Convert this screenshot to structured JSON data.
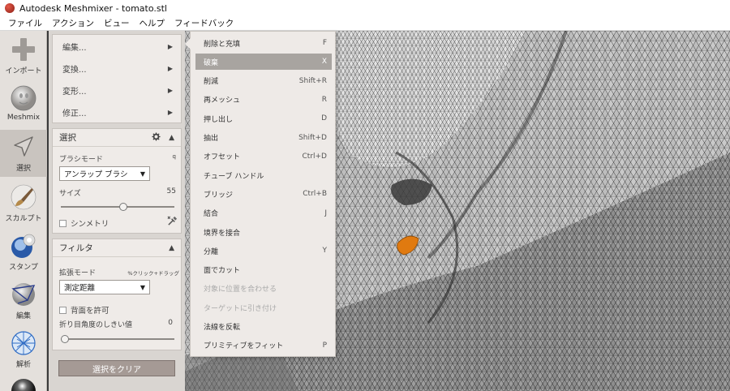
{
  "window": {
    "title": "Autodesk Meshmixer - tomato.stl"
  },
  "menubar": {
    "items": [
      "ファイル",
      "アクション",
      "ビュー",
      "ヘルプ",
      "フィードバック"
    ]
  },
  "toolbar": {
    "import_label": "インポート",
    "meshmix_label": "Meshmix",
    "select_label": "選択",
    "sculpt_label": "スカルプト",
    "stamp_label": "スタンプ",
    "edit_label": "編集",
    "analysis_label": "解析"
  },
  "submenu": {
    "items": [
      "編集...",
      "変換...",
      "変形...",
      "修正..."
    ]
  },
  "select_panel": {
    "title": "選択",
    "brush_mode_label": "ブラシモード",
    "brush_mode_key": "q",
    "brush_mode_value": "アンラップ ブラシ",
    "size_label": "サイズ",
    "size_value": "55",
    "size_fraction": 0.55,
    "symmetry_label": "シンメトリ"
  },
  "filter_panel": {
    "title": "フィルタ",
    "expand_mode_label": "拡張モード",
    "expand_mode_hint": "%クリック+ドラッグ",
    "expand_mode_value": "測定距離",
    "allow_back_label": "背面を許可",
    "crease_angle_label": "折り目角度のしきい値",
    "crease_angle_value": "0",
    "crease_fraction": 0.0
  },
  "clear_button": {
    "label": "選択をクリア"
  },
  "popup_menu": {
    "items": [
      {
        "label": "削除と充填",
        "shortcut": "F",
        "state": "normal"
      },
      {
        "label": "破棄",
        "shortcut": "X",
        "state": "highlight"
      },
      {
        "label": "削減",
        "shortcut": "Shift+R",
        "state": "normal"
      },
      {
        "label": "再メッシュ",
        "shortcut": "R",
        "state": "normal"
      },
      {
        "label": "押し出し",
        "shortcut": "D",
        "state": "normal"
      },
      {
        "label": "抽出",
        "shortcut": "Shift+D",
        "state": "normal"
      },
      {
        "label": "オフセット",
        "shortcut": "Ctrl+D",
        "state": "normal"
      },
      {
        "label": "チューブ ハンドル",
        "shortcut": "",
        "state": "normal"
      },
      {
        "label": "ブリッジ",
        "shortcut": "Ctrl+B",
        "state": "normal"
      },
      {
        "label": "結合",
        "shortcut": "J",
        "state": "normal"
      },
      {
        "label": "境界を接合",
        "shortcut": "",
        "state": "normal"
      },
      {
        "label": "分離",
        "shortcut": "Y",
        "state": "normal"
      },
      {
        "label": "面でカット",
        "shortcut": "",
        "state": "normal"
      },
      {
        "label": "対象に位置を合わせる",
        "shortcut": "",
        "state": "disabled"
      },
      {
        "label": "ターゲットに引き付け",
        "shortcut": "",
        "state": "disabled"
      },
      {
        "label": "法線を反転",
        "shortcut": "",
        "state": "normal"
      },
      {
        "label": "プリミティブをフィット",
        "shortcut": "P",
        "state": "normal"
      }
    ]
  },
  "colors": {
    "selection_orange": "#e07a10",
    "highlight_gray": "#a8a4a0",
    "clear_button": "#a59a95"
  },
  "icons": {
    "import": "plus-icon",
    "meshmix": "meshmix-head-icon",
    "select": "cursor-arrow-icon",
    "sculpt": "brush-icon",
    "stamp": "stamp-icon",
    "edit": "edit-mesh-icon",
    "analysis": "analysis-sphere-icon",
    "panel_settings": "gear-icon",
    "panel_collapse": "triangle-up-icon",
    "symmetry_tool": "wrench-icon"
  }
}
